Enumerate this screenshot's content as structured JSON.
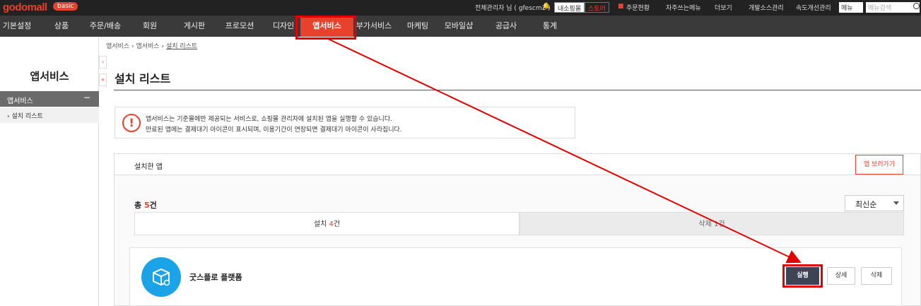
{
  "topbar": {
    "logo": "godomall",
    "badge": "basic",
    "admin_name": "전체관리자 님 ( gfescm2 )",
    "btn_internal": "내소핑몰",
    "btn_store": "스토어",
    "order_status": "주문현황",
    "favorites": "자주쓰는메뉴",
    "more": "더보기",
    "dev_source": "개발소스관리",
    "speed": "속도개선관리",
    "menu_select": "메뉴",
    "search_placeholder": "메뉴검색"
  },
  "nav": {
    "items": [
      "기본설정",
      "상품",
      "주문/배송",
      "회원",
      "게시판",
      "프로모션",
      "디자인",
      "앱서비스",
      "부가서비스",
      "마케팅",
      "모바일샵",
      "공급사",
      "통계"
    ]
  },
  "sidebar": {
    "title": "앱서비스",
    "section": "앱서비스",
    "item": "설치 리스트",
    "collapse_1": "‹",
    "collapse_2": "«"
  },
  "breadcrumb": {
    "part1": "앱서비스",
    "part2": "앱서비스",
    "part3": "설치 리스트"
  },
  "page": {
    "title": "설치 리스트"
  },
  "notice": {
    "line1": "앱서비스는 기준몰에만 제공되는 서비스로, 쇼핑몰 관리자에 설치된 앱을 실행할 수 있습니다.",
    "line2": "만료된 앱에는 결제대기 아이콘이 표시되며, 이용기간이 연장되면 결제대기 아이콘이 사라집니다."
  },
  "installed": {
    "panel_title": "설치한 앱",
    "store_button": "앱 보러가기",
    "total_prefix": "총",
    "total_count": "5",
    "total_suffix": "건",
    "sort": "최신순",
    "tab_installed_label": "설치",
    "tab_installed_count": "4",
    "tab_installed_suffix": "건",
    "tab_deleted_label": "삭제",
    "tab_deleted_count": "1",
    "tab_deleted_suffix": "건"
  },
  "app": {
    "name": "굿스플로 플랫폼",
    "run": "실행",
    "detail": "상세",
    "delete": "삭제"
  },
  "colors": {
    "accent": "#e8412c",
    "annotation": "#e50000",
    "run_button": "#3d4456",
    "app_logo": "#1ba3e8"
  }
}
